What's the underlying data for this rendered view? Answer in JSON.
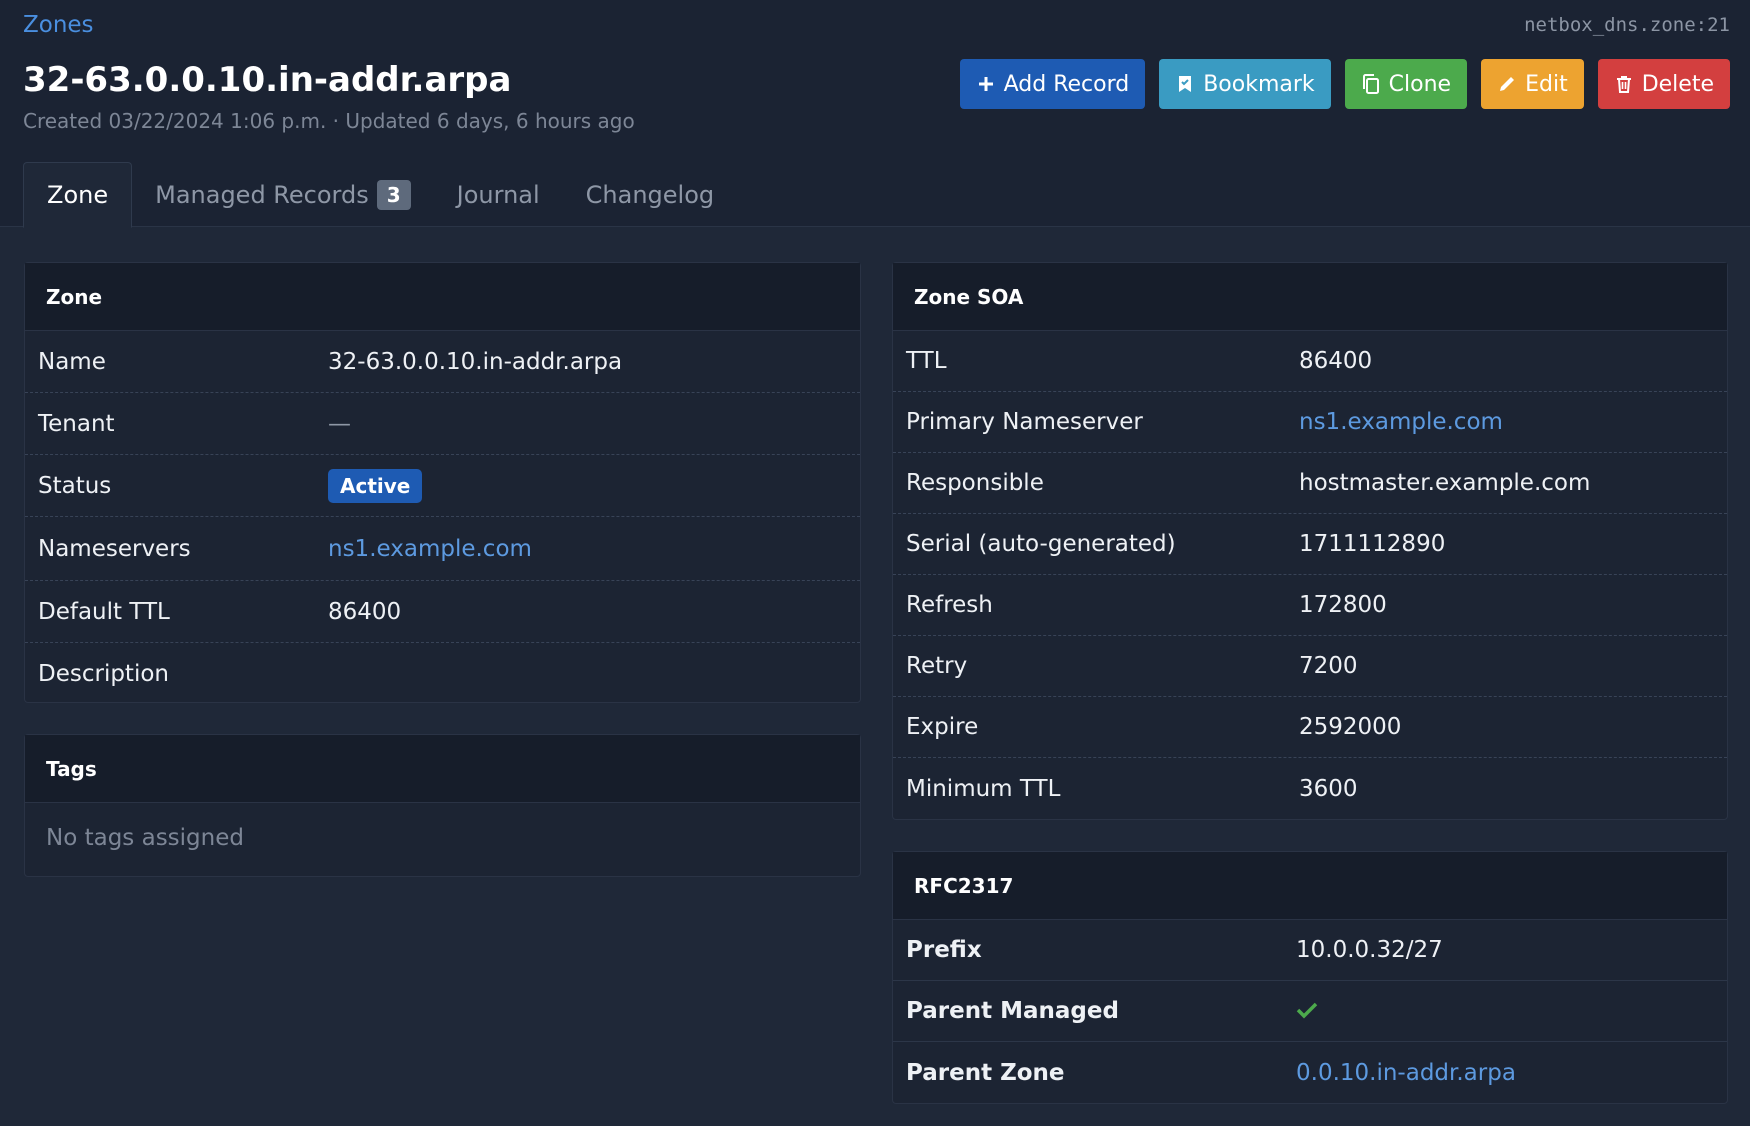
{
  "breadcrumb": "Zones",
  "object_id": "netbox_dns.zone:21",
  "title": "32-63.0.0.10.in-addr.arpa",
  "meta": "Created 03/22/2024 1:06 p.m. · Updated 6 days, 6 hours ago",
  "actions": {
    "add_record": "Add Record",
    "bookmark": "Bookmark",
    "clone": "Clone",
    "edit": "Edit",
    "delete": "Delete"
  },
  "colors": {
    "add_record": "#1e5bb3",
    "bookmark": "#3a9bc2",
    "clone": "#4caa4c",
    "edit": "#eda330",
    "delete": "#d33f3f"
  },
  "tabs": {
    "zone": "Zone",
    "managed_records": "Managed Records",
    "managed_records_count": "3",
    "journal": "Journal",
    "changelog": "Changelog"
  },
  "zone_card": {
    "title": "Zone",
    "rows": {
      "name_label": "Name",
      "name_value": "32-63.0.0.10.in-addr.arpa",
      "tenant_label": "Tenant",
      "tenant_value": "—",
      "status_label": "Status",
      "status_value": "Active",
      "nameservers_label": "Nameservers",
      "nameservers_value": "ns1.example.com",
      "default_ttl_label": "Default TTL",
      "default_ttl_value": "86400",
      "description_label": "Description"
    }
  },
  "tags_card": {
    "title": "Tags",
    "empty": "No tags assigned"
  },
  "soa_card": {
    "title": "Zone SOA",
    "rows": {
      "ttl_label": "TTL",
      "ttl_value": "86400",
      "primary_ns_label": "Primary Nameserver",
      "primary_ns_value": "ns1.example.com",
      "responsible_label": "Responsible",
      "responsible_value": "hostmaster.example.com",
      "serial_label": "Serial (auto-generated)",
      "serial_value": "1711112890",
      "refresh_label": "Refresh",
      "refresh_value": "172800",
      "retry_label": "Retry",
      "retry_value": "7200",
      "expire_label": "Expire",
      "expire_value": "2592000",
      "min_ttl_label": "Minimum TTL",
      "min_ttl_value": "3600"
    }
  },
  "rfc_card": {
    "title": "RFC2317",
    "rows": {
      "prefix_label": "Prefix",
      "prefix_value": "10.0.0.32/27",
      "parent_managed_label": "Parent Managed",
      "parent_zone_label": "Parent Zone",
      "parent_zone_value": "0.0.10.in-addr.arpa"
    }
  }
}
